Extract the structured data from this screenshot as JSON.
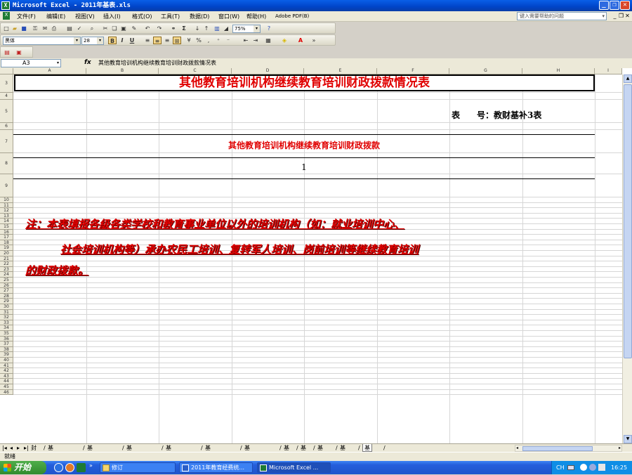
{
  "window": {
    "title": "Microsoft Excel - 2011年基表.xls",
    "app_icon_letter": "X"
  },
  "menu": {
    "items": [
      "文件(F)",
      "编辑(E)",
      "视图(V)",
      "插入(I)",
      "格式(O)",
      "工具(T)",
      "数据(D)",
      "窗口(W)",
      "帮助(H)",
      "Adobe PDF(B)"
    ],
    "help_placeholder": "键入需要帮助的问题"
  },
  "toolbar": {
    "zoom": "75%",
    "font_name": "黑体",
    "font_size": "28",
    "bold": "B",
    "italic": "I",
    "underline": "U",
    "sum": "Σ",
    "percent": "%"
  },
  "formula_bar": {
    "name_box": "A3",
    "fx": "fx",
    "formula": "其他教育培训机构继续教育培训财政拨款情况表"
  },
  "grid": {
    "columns": [
      "A",
      "B",
      "C",
      "D",
      "E",
      "F",
      "G",
      "H",
      "I"
    ],
    "rows": [
      "3",
      "4",
      "5",
      "6",
      "7",
      "8",
      "9",
      "10",
      "11",
      "12",
      "13",
      "14",
      "15",
      "16",
      "17",
      "18",
      "19",
      "20",
      "21",
      "22",
      "23",
      "24",
      "25",
      "26",
      "27",
      "28",
      "29",
      "30",
      "31",
      "32",
      "33",
      "34",
      "35",
      "36",
      "37",
      "38",
      "39",
      "40",
      "41",
      "42",
      "43",
      "44",
      "45",
      "46"
    ]
  },
  "sheet": {
    "title": "其他教育培训机构继续教育培训财政拨款情况表",
    "table_no_label": "表　　号：",
    "table_no_value": "教财基补3表",
    "column_header": "其他教育培训机构继续教育培训财政拨款",
    "column_index": "1",
    "note_line1": "注：本表填报各级各类学校和教育事业单位以外的培训机构（如：就业培训中心、",
    "note_line2": "社会培训机构等）承办农民工培训、复转军人培训、岗前培训等继续教育培训",
    "note_line3": "的财政拨款。"
  },
  "sheet_tabs": {
    "items": [
      "封面",
      "基1-1、2",
      "基1-3、4",
      "基2-1、2",
      "基2-3、4",
      "基3-1、2",
      "基3-3、4",
      "基4",
      "基5",
      "基补1",
      "基补2",
      "基补3"
    ],
    "active": "基补3"
  },
  "status": {
    "text": "就绪"
  },
  "taskbar": {
    "start": "开始",
    "buttons": [
      "修订",
      "2011年教育经费统...",
      "Microsoft Excel ..."
    ],
    "tray_lang": "CH",
    "clock": "16:25"
  },
  "colors": {
    "title_red": "#e00000",
    "taskbar_blue": "#245edb",
    "start_green": "#318a2d"
  }
}
